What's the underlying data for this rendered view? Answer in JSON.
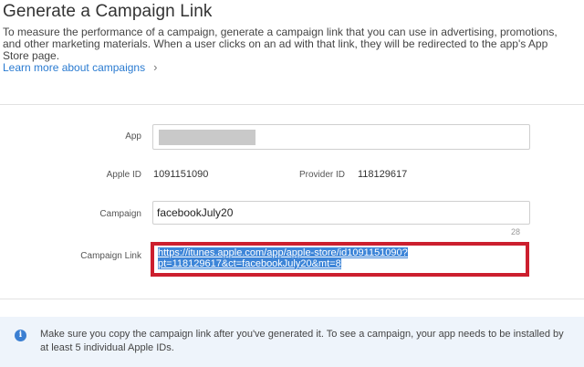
{
  "header": {
    "title": "Generate a Campaign Link",
    "description": "To measure the performance of a campaign, generate a campaign link that you can use in advertising, promotions, and other marketing materials. When a user clicks on an ad with that link, they will be redirected to the app's App Store page.",
    "learn_more": "Learn more about campaigns"
  },
  "form": {
    "app_label": "App",
    "apple_id_label": "Apple ID",
    "apple_id_value": "1091151090",
    "provider_id_label": "Provider ID",
    "provider_id_value": "118129617",
    "campaign_label": "Campaign",
    "campaign_value": "facebookJuly20",
    "campaign_counter": "28",
    "link_label": "Campaign Link",
    "link_line1": "https://itunes.apple.com/app/apple-store/id1091151090?",
    "link_line2": "pt=118129617&ct=facebookJuly20&mt=8"
  },
  "notice": {
    "icon": "info-icon",
    "text": "Make sure you copy the campaign link after you've generated it. To see a campaign, your app needs to be installed by at least 5 individual Apple IDs."
  },
  "colors": {
    "accent": "#2a7bd1",
    "highlight_border": "#cc1f2e",
    "selection": "#3d85d8",
    "notice_bg": "#eef4fb"
  }
}
